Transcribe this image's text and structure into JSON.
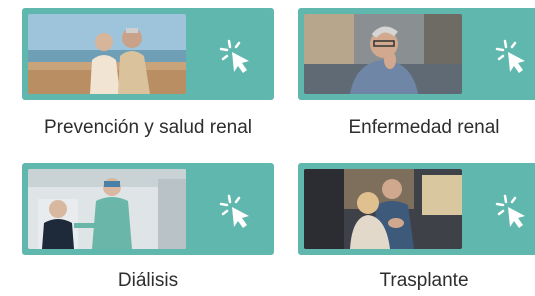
{
  "cards": [
    {
      "label": "Prevención y salud renal",
      "icon": "pointer-click-icon",
      "image": "elderly-couple-beach-photo"
    },
    {
      "label": "Enfermedad renal",
      "icon": "pointer-click-icon",
      "image": "pensive-man-sofa-photo"
    },
    {
      "label": "Diálisis",
      "icon": "pointer-click-icon",
      "image": "dialysis-nurse-patient-photo"
    },
    {
      "label": "Trasplante",
      "icon": "pointer-click-icon",
      "image": "couple-embrace-kitchen-photo"
    }
  ],
  "colors": {
    "card_teal": "#5fb7ad",
    "label_text": "#2e2e2e",
    "icon_white": "#ffffff"
  }
}
